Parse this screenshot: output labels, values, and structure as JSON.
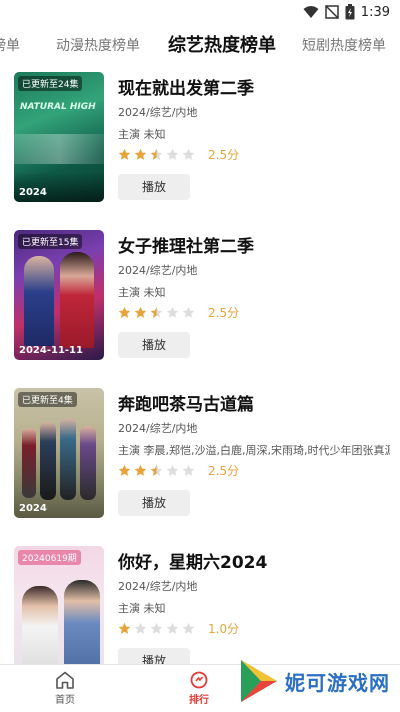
{
  "status_bar": {
    "time": "1:39"
  },
  "tabs": [
    {
      "label": "榜单",
      "active": false
    },
    {
      "label": "动漫热度榜单",
      "active": false
    },
    {
      "label": "综艺热度榜单",
      "active": true
    },
    {
      "label": "短剧热度榜单",
      "active": false
    }
  ],
  "items": [
    {
      "badge": "已更新至24集",
      "poster_text": "2024",
      "poster_art": "NATURAL HIGH",
      "title": "现在就出发第二季",
      "meta": "2024/综艺/内地",
      "cast": "主演 未知",
      "rating": 2.5,
      "score": "2.5分",
      "play_label": "播放"
    },
    {
      "badge": "已更新至15集",
      "poster_text": "2024-11-11",
      "title": "女子推理社第二季",
      "meta": "2024/综艺/内地",
      "cast": "主演 未知",
      "rating": 2.5,
      "score": "2.5分",
      "play_label": "播放"
    },
    {
      "badge": "已更新至4集",
      "poster_text": "2024",
      "title": "奔跑吧茶马古道篇",
      "meta": "2024/综艺/内地",
      "cast": "主演 李晨,郑恺,沙溢,白鹿,周深,宋雨琦,时代少年团张真源",
      "rating": 2.5,
      "score": "2.5分",
      "play_label": "播放"
    },
    {
      "badge": "20240619期",
      "poster_text": "",
      "title": "你好，星期六2024",
      "meta": "2024/综艺/内地",
      "cast": "主演 未知",
      "rating": 1.0,
      "score": "1.0分",
      "play_label": "播放"
    }
  ],
  "bottom_nav": {
    "home_label": "首页",
    "rank_label": "排行"
  },
  "watermark": {
    "text": "妮可游戏网"
  },
  "colors": {
    "accent": "#e53935",
    "star": "#e8a33a",
    "star_empty": "#dddddd"
  }
}
